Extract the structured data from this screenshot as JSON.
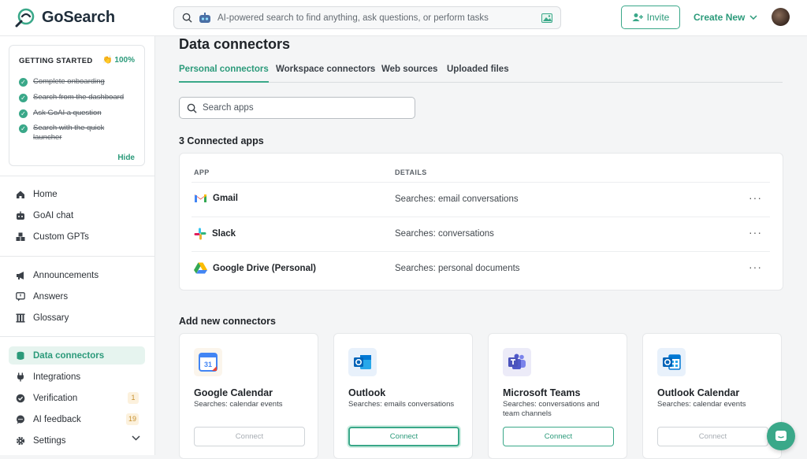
{
  "header": {
    "logo_text": "GoSearch",
    "search_placeholder": "AI-powered search to find anything, ask questions, or perform tasks",
    "invite_label": "Invite",
    "create_new_label": "Create New"
  },
  "getting_started": {
    "title": "GETTING STARTED",
    "percent": "100%",
    "items": [
      "Complete onboarding",
      "Search from the dashboard",
      "Ask GoAI a question",
      "Search with the quick launcher"
    ],
    "hide_label": "Hide"
  },
  "sidebar": {
    "group1": [
      "Home",
      "GoAI chat",
      "Custom GPTs"
    ],
    "group2": [
      "Announcements",
      "Answers",
      "Glossary"
    ],
    "group3": [
      {
        "label": "Data connectors",
        "active": true
      },
      {
        "label": "Integrations"
      },
      {
        "label": "Verification",
        "badge": "1"
      },
      {
        "label": "AI feedback",
        "badge": "19"
      },
      {
        "label": "Settings"
      }
    ]
  },
  "main": {
    "title": "Data connectors",
    "tabs": [
      "Personal connectors",
      "Workspace connectors",
      "Web sources",
      "Uploaded files"
    ],
    "search_placeholder": "Search apps",
    "connected_heading": "3 Connected apps",
    "columns": [
      "APP",
      "DETAILS"
    ],
    "connected": [
      {
        "app": "Gmail",
        "details": "Searches: email conversations"
      },
      {
        "app": "Slack",
        "details": "Searches: conversations"
      },
      {
        "app": "Google Drive (Personal)",
        "details": "Searches: personal documents"
      }
    ],
    "add_heading": "Add new connectors",
    "connectors": [
      {
        "name": "Google Calendar",
        "desc": "Searches: calendar events",
        "button": "Connect"
      },
      {
        "name": "Outlook",
        "desc": "Searches: emails conversations",
        "button": "Connect"
      },
      {
        "name": "Microsoft Teams",
        "desc": "Searches: conversations and team channels",
        "button": "Connect"
      },
      {
        "name": "Outlook Calendar",
        "desc": "Searches: calendar events",
        "button": "Connect"
      }
    ]
  },
  "colors": {
    "accent": "#3aa889",
    "accent_text": "#2b9a7a",
    "active_bg": "#e6f4ef",
    "badge_bg": "#fcf1dd"
  }
}
